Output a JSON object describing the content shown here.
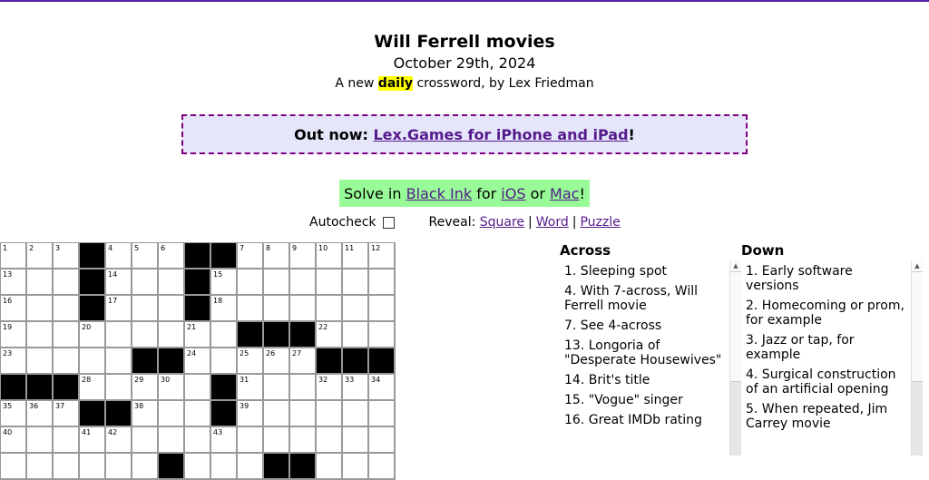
{
  "header": {
    "title": "Will Ferrell movies",
    "date": "October 29th, 2024",
    "byline_pre": "A new ",
    "byline_highlight": "daily",
    "byline_post": " crossword, by Lex Friedman"
  },
  "promo": {
    "prefix": "Out now: ",
    "link": "Lex.Games for iPhone and iPad",
    "suffix": "!"
  },
  "solve": {
    "prefix": "Solve in ",
    "app_link": "Black Ink",
    "mid": " for ",
    "ios_link": "iOS",
    "or": " or ",
    "mac_link": "Mac",
    "suffix": "!"
  },
  "controls": {
    "autocheck_label": "Autocheck",
    "autocheck_checked": false,
    "reveal_label": "Reveal:",
    "reveal_square": "Square",
    "reveal_word": "Word",
    "reveal_puzzle": "Puzzle",
    "separator": "|"
  },
  "grid": {
    "cols": 15,
    "rows": [
      [
        "1",
        "2",
        "3",
        "#",
        "4",
        "5",
        "6",
        "#",
        "#",
        "7",
        "8",
        "9",
        "10",
        "11",
        "12"
      ],
      [
        "13",
        "",
        "",
        "#",
        "14",
        "",
        "",
        "#",
        "15",
        "",
        "",
        "",
        "",
        "",
        ""
      ],
      [
        "16",
        "",
        "",
        "#",
        "17",
        "",
        "",
        "#",
        "18",
        "",
        "",
        "",
        "",
        "",
        ""
      ],
      [
        "19",
        "",
        "",
        "20",
        "",
        "",
        "",
        "21",
        "",
        "#",
        "#",
        "#",
        "22",
        "",
        ""
      ],
      [
        "23",
        "",
        "",
        "",
        "",
        "#",
        "#",
        "24",
        "",
        "25",
        "26",
        "27",
        "#",
        "#",
        "#"
      ],
      [
        "#",
        "#",
        "#",
        "28",
        "",
        "29",
        "30",
        "",
        "#",
        "31",
        "",
        "",
        "32",
        "33",
        "34"
      ],
      [
        "35",
        "36",
        "37",
        "#",
        "#",
        "38",
        "",
        "",
        "#",
        "39",
        "",
        "",
        "",
        "",
        ""
      ],
      [
        "40",
        "",
        "",
        "41",
        "42",
        "",
        "",
        "",
        "43",
        "",
        "",
        "",
        "",
        "",
        ""
      ],
      [
        "",
        "",
        "",
        "",
        "",
        "",
        "#",
        "",
        "",
        "",
        "#",
        "#",
        "",
        "",
        ""
      ]
    ]
  },
  "across": {
    "heading": "Across",
    "clues": [
      "1. Sleeping spot",
      "4. With 7-across, Will Ferrell movie",
      "7. See 4-across",
      "13. Longoria of \"Desperate Housewives\"",
      "14. Brit's title",
      "15. \"Vogue\" singer",
      "16. Great IMDb rating"
    ]
  },
  "down": {
    "heading": "Down",
    "clues": [
      "1. Early software versions",
      "2. Homecoming or prom, for example",
      "3. Jazz or tap, for example",
      "4. Surgical construction of an artificial opening",
      "5. When repeated, Jim Carrey movie"
    ]
  }
}
